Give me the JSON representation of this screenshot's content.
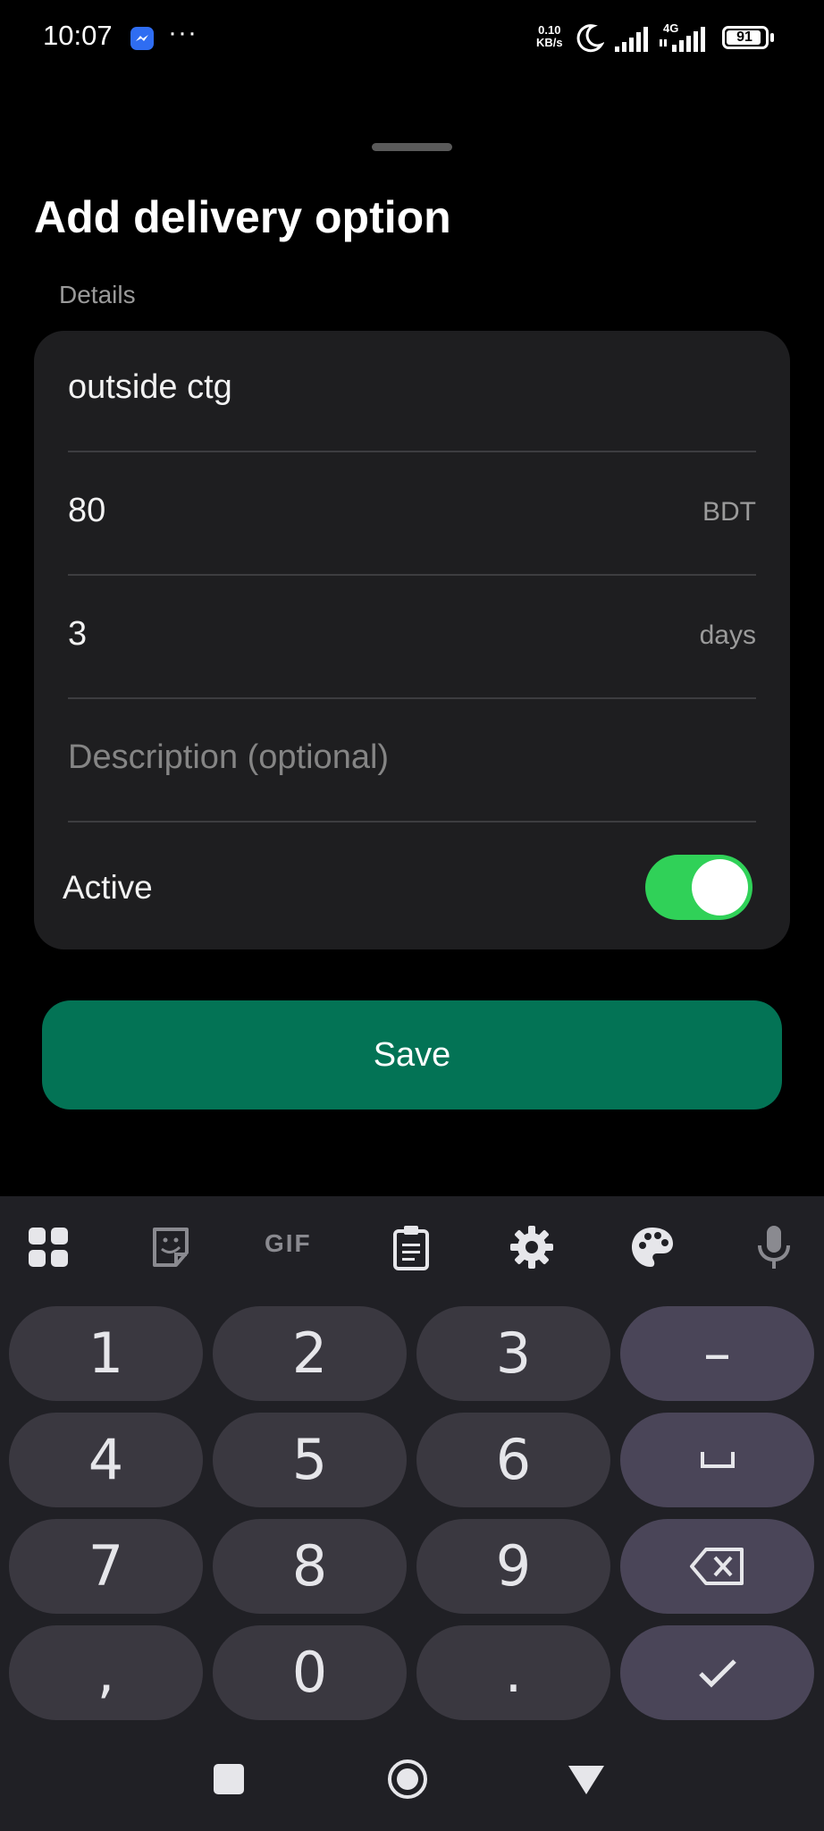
{
  "status_bar": {
    "time": "10:07",
    "more": "···",
    "net_speed_value": "0.10",
    "net_speed_unit": "KB/s",
    "network_type": "4G",
    "battery": "91"
  },
  "sheet": {
    "title": "Add delivery option",
    "section_label": "Details",
    "fields": [
      {
        "value": "outside ctg",
        "suffix": ""
      },
      {
        "value": "80",
        "suffix": "BDT"
      },
      {
        "value": "3",
        "suffix": "days"
      },
      {
        "value": "",
        "placeholder": "Description (optional)",
        "suffix": ""
      }
    ],
    "active_label": "Active",
    "active_on": true,
    "save_label": "Save"
  },
  "keyboard": {
    "toolbar": [
      "apps-grid-icon",
      "sticker-icon",
      "GIF",
      "clipboard-icon",
      "settings-gear-icon",
      "palette-icon",
      "microphone-icon"
    ],
    "rows": [
      [
        "1",
        "2",
        "3",
        "–"
      ],
      [
        "4",
        "5",
        "6",
        "␣"
      ],
      [
        "7",
        "8",
        "9",
        "⌫"
      ],
      [
        ",",
        "0",
        ".",
        "✓"
      ]
    ]
  },
  "colors": {
    "accent_green": "#037355",
    "toggle_green": "#30d158",
    "card_bg": "#1e1e20",
    "keyboard_bg": "#202025"
  }
}
